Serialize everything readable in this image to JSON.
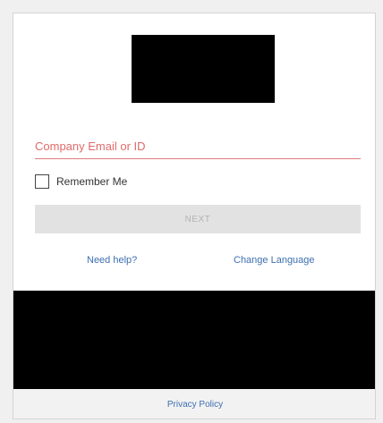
{
  "login": {
    "email_placeholder": "Company Email or ID",
    "email_value": "",
    "remember_label": "Remember Me",
    "next_label": "NEXT",
    "need_help_label": "Need help?",
    "change_language_label": "Change Language"
  },
  "footer": {
    "privacy_label": "Privacy Policy"
  },
  "colors": {
    "accent_error": "#e06a6a",
    "link": "#3d6fb0",
    "button_disabled_bg": "#e2e2e2"
  }
}
